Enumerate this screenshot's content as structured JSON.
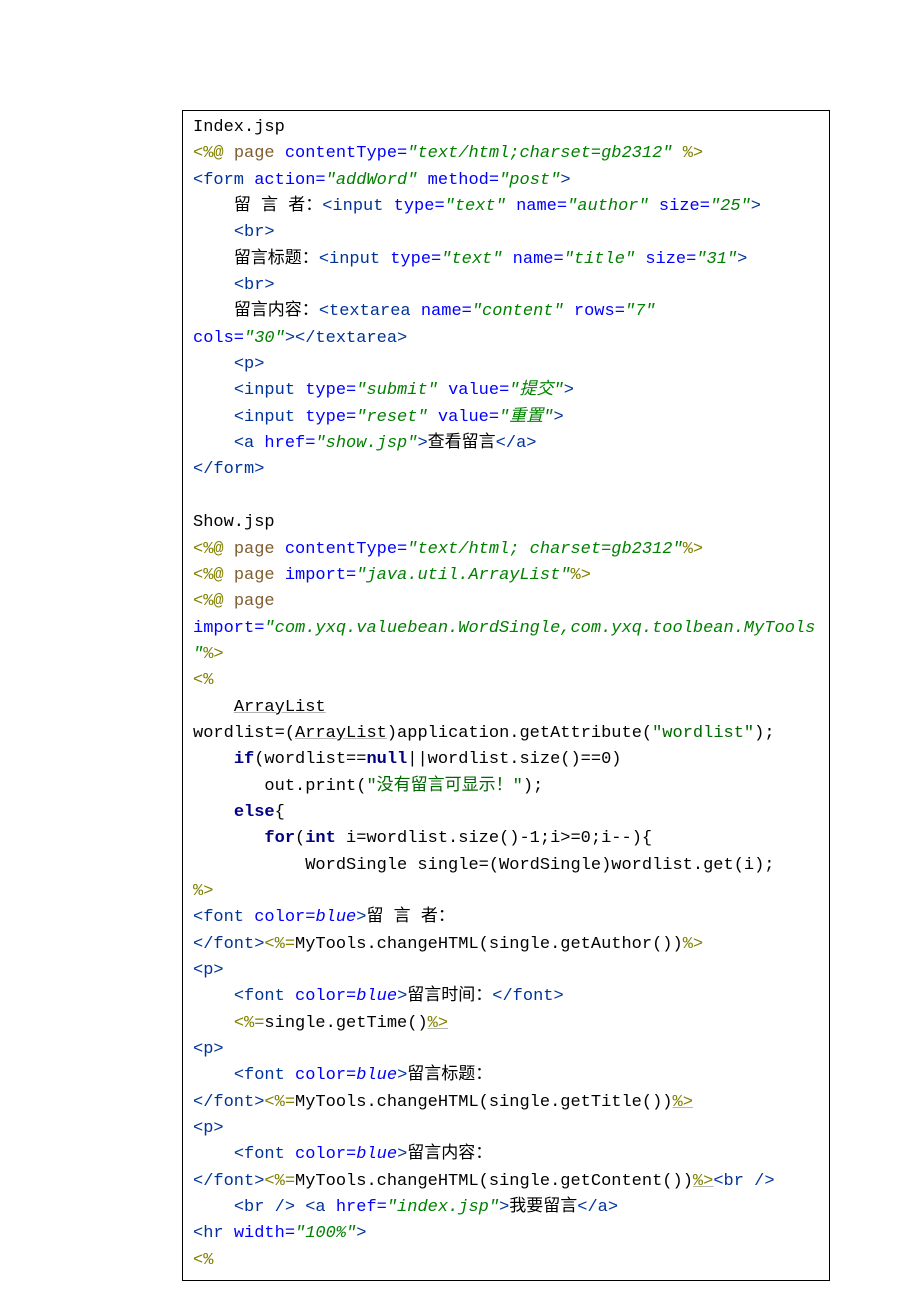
{
  "code_lines": [
    [
      [
        "c-plain",
        "Index.jsp"
      ]
    ],
    [
      [
        "c-olive",
        "<%@ "
      ],
      [
        "c-brown",
        "page "
      ],
      [
        "c-attr",
        "contentType="
      ],
      [
        "c-str",
        "\"text/html;charset=gb2312\" "
      ],
      [
        "c-olive",
        "%>"
      ]
    ],
    [
      [
        "c-tag",
        "<form "
      ],
      [
        "c-attr",
        "action="
      ],
      [
        "c-str",
        "\"addWord\" "
      ],
      [
        "c-attr",
        "method="
      ],
      [
        "c-str",
        "\"post\""
      ],
      [
        "c-tag",
        ">"
      ]
    ],
    [
      [
        "c-plain",
        "    留 言 者："
      ],
      [
        "c-tag",
        "<input "
      ],
      [
        "c-attr",
        "type="
      ],
      [
        "c-str",
        "\"text\" "
      ],
      [
        "c-attr",
        "name="
      ],
      [
        "c-str",
        "\"author\" "
      ],
      [
        "c-attr",
        "size="
      ],
      [
        "c-str",
        "\"25\""
      ],
      [
        "c-tag",
        ">"
      ]
    ],
    [
      [
        "c-plain",
        "    "
      ],
      [
        "c-tag",
        "<br>"
      ]
    ],
    [
      [
        "c-plain",
        "    留言标题："
      ],
      [
        "c-tag",
        "<input "
      ],
      [
        "c-attr",
        "type="
      ],
      [
        "c-str",
        "\"text\" "
      ],
      [
        "c-attr",
        "name="
      ],
      [
        "c-str",
        "\"title\" "
      ],
      [
        "c-attr",
        "size="
      ],
      [
        "c-str",
        "\"31\""
      ],
      [
        "c-tag",
        ">"
      ]
    ],
    [
      [
        "c-plain",
        "    "
      ],
      [
        "c-tag",
        "<br>"
      ]
    ],
    [
      [
        "c-plain",
        "    留言内容："
      ],
      [
        "c-tag",
        "<textarea "
      ],
      [
        "c-attr",
        "name="
      ],
      [
        "c-str",
        "\"content\" "
      ],
      [
        "c-attr",
        "rows="
      ],
      [
        "c-str",
        "\"7\" "
      ]
    ],
    [
      [
        "c-attr",
        "cols="
      ],
      [
        "c-str",
        "\"30\""
      ],
      [
        "c-tag",
        "></textarea>"
      ]
    ],
    [
      [
        "c-plain",
        "    "
      ],
      [
        "c-tag",
        "<p>"
      ]
    ],
    [
      [
        "c-plain",
        "    "
      ],
      [
        "c-tag",
        "<input "
      ],
      [
        "c-attr",
        "type="
      ],
      [
        "c-str",
        "\"submit\" "
      ],
      [
        "c-attr",
        "value="
      ],
      [
        "c-str",
        "\"提交\""
      ],
      [
        "c-tag",
        ">"
      ]
    ],
    [
      [
        "c-plain",
        "    "
      ],
      [
        "c-tag",
        "<input "
      ],
      [
        "c-attr",
        "type="
      ],
      [
        "c-str",
        "\"reset\" "
      ],
      [
        "c-attr",
        "value="
      ],
      [
        "c-str",
        "\"重置\""
      ],
      [
        "c-tag",
        ">"
      ]
    ],
    [
      [
        "c-plain",
        "    "
      ],
      [
        "c-tag",
        "<a "
      ],
      [
        "c-attr",
        "href="
      ],
      [
        "c-str",
        "\"show.jsp\""
      ],
      [
        "c-tag",
        ">"
      ],
      [
        "c-plain",
        "查看留言"
      ],
      [
        "c-tag",
        "</a>"
      ]
    ],
    [
      [
        "c-tag",
        "</form>"
      ]
    ],
    [
      [
        "c-plain",
        ""
      ]
    ],
    [
      [
        "c-plain",
        "Show.jsp"
      ]
    ],
    [
      [
        "c-olive",
        "<%@ "
      ],
      [
        "c-brown",
        "page "
      ],
      [
        "c-attr",
        "contentType="
      ],
      [
        "c-str",
        "\"text/html; charset=gb2312\""
      ],
      [
        "c-olive",
        "%>"
      ]
    ],
    [
      [
        "c-olive",
        "<%@ "
      ],
      [
        "c-brown",
        "page "
      ],
      [
        "c-attr",
        "import="
      ],
      [
        "c-str",
        "\"java.util.ArrayList\""
      ],
      [
        "c-olive",
        "%>"
      ]
    ],
    [
      [
        "c-olive",
        "<%@ "
      ],
      [
        "c-brown",
        "page "
      ]
    ],
    [
      [
        "c-attr",
        "import="
      ],
      [
        "c-str",
        "\"com.yxq.valuebean.WordSingle,com.yxq.toolbean.MyTools"
      ]
    ],
    [
      [
        "c-str",
        "\""
      ],
      [
        "c-olive",
        "%>"
      ]
    ],
    [
      [
        "c-olive",
        "<%"
      ]
    ],
    [
      [
        "c-plain",
        "    "
      ],
      [
        "c-plain c-under",
        "ArrayList"
      ]
    ],
    [
      [
        "c-plain",
        "wordlist=("
      ],
      [
        "c-plain c-under",
        "ArrayList"
      ],
      [
        "c-plain",
        ")application.getAttribute("
      ],
      [
        "c-lit",
        "\"wordlist\""
      ],
      [
        "c-plain",
        ");"
      ]
    ],
    [
      [
        "c-plain",
        "    "
      ],
      [
        "c-kw",
        "if"
      ],
      [
        "c-plain",
        "(wordlist=="
      ],
      [
        "c-kw",
        "null"
      ],
      [
        "c-plain",
        "||wordlist.size()==0)"
      ]
    ],
    [
      [
        "c-plain",
        "       out.print("
      ],
      [
        "c-lit",
        "\"没有留言可显示！\""
      ],
      [
        "c-plain",
        ");"
      ]
    ],
    [
      [
        "c-plain",
        "    "
      ],
      [
        "c-kw",
        "else"
      ],
      [
        "c-plain",
        "{"
      ]
    ],
    [
      [
        "c-plain",
        "       "
      ],
      [
        "c-kw",
        "for"
      ],
      [
        "c-plain",
        "("
      ],
      [
        "c-kw",
        "int"
      ],
      [
        "c-plain",
        " i=wordlist.size()-1;i>=0;i--){"
      ]
    ],
    [
      [
        "c-plain",
        "           WordSingle single=(WordSingle)wordlist.get(i);"
      ]
    ],
    [
      [
        "c-olive",
        "%>"
      ]
    ],
    [
      [
        "c-tag",
        "<font "
      ],
      [
        "c-attr",
        "color="
      ],
      [
        "c-blue",
        "blue"
      ],
      [
        "c-tag",
        ">"
      ],
      [
        "c-plain",
        "留 言 者："
      ]
    ],
    [
      [
        "c-tag",
        "</font>"
      ],
      [
        "c-olive",
        "<%="
      ],
      [
        "c-plain",
        "MyTools.changeHTML(single.getAuthor())"
      ],
      [
        "c-olive",
        "%>"
      ]
    ],
    [
      [
        "c-tag",
        "<p>"
      ]
    ],
    [
      [
        "c-plain",
        "    "
      ],
      [
        "c-tag",
        "<font "
      ],
      [
        "c-attr",
        "color="
      ],
      [
        "c-blue",
        "blue"
      ],
      [
        "c-tag",
        ">"
      ],
      [
        "c-plain",
        "留言时间："
      ],
      [
        "c-tag",
        "</font>"
      ]
    ],
    [
      [
        "c-plain",
        "    "
      ],
      [
        "c-olive",
        "<%="
      ],
      [
        "c-plain",
        "single.getTime()"
      ],
      [
        "c-olive c-under",
        "%>"
      ]
    ],
    [
      [
        "c-tag",
        "<p>"
      ]
    ],
    [
      [
        "c-plain",
        "    "
      ],
      [
        "c-tag",
        "<font "
      ],
      [
        "c-attr",
        "color="
      ],
      [
        "c-blue",
        "blue"
      ],
      [
        "c-tag",
        ">"
      ],
      [
        "c-plain",
        "留言标题："
      ]
    ],
    [
      [
        "c-tag",
        "</font>"
      ],
      [
        "c-olive",
        "<%="
      ],
      [
        "c-plain",
        "MyTools.changeHTML(single.getTitle())"
      ],
      [
        "c-olive c-under",
        "%>"
      ]
    ],
    [
      [
        "c-tag",
        "<p>"
      ]
    ],
    [
      [
        "c-plain",
        "    "
      ],
      [
        "c-tag",
        "<font "
      ],
      [
        "c-attr",
        "color="
      ],
      [
        "c-blue",
        "blue"
      ],
      [
        "c-tag",
        ">"
      ],
      [
        "c-plain",
        "留言内容："
      ]
    ],
    [
      [
        "c-tag",
        "</font>"
      ],
      [
        "c-olive",
        "<%="
      ],
      [
        "c-plain",
        "MyTools.changeHTML(single.getContent())"
      ],
      [
        "c-olive c-under",
        "%>"
      ],
      [
        "c-tag",
        "<br />"
      ]
    ],
    [
      [
        "c-plain",
        "    "
      ],
      [
        "c-tag",
        "<br /> <a "
      ],
      [
        "c-attr",
        "href="
      ],
      [
        "c-str",
        "\"index.jsp\""
      ],
      [
        "c-tag",
        ">"
      ],
      [
        "c-plain",
        "我要留言"
      ],
      [
        "c-tag",
        "</a>"
      ]
    ],
    [
      [
        "c-tag",
        "<hr "
      ],
      [
        "c-attr",
        "width="
      ],
      [
        "c-str",
        "\"100%\""
      ],
      [
        "c-tag",
        ">"
      ]
    ],
    [
      [
        "c-olive",
        "<%"
      ]
    ]
  ]
}
